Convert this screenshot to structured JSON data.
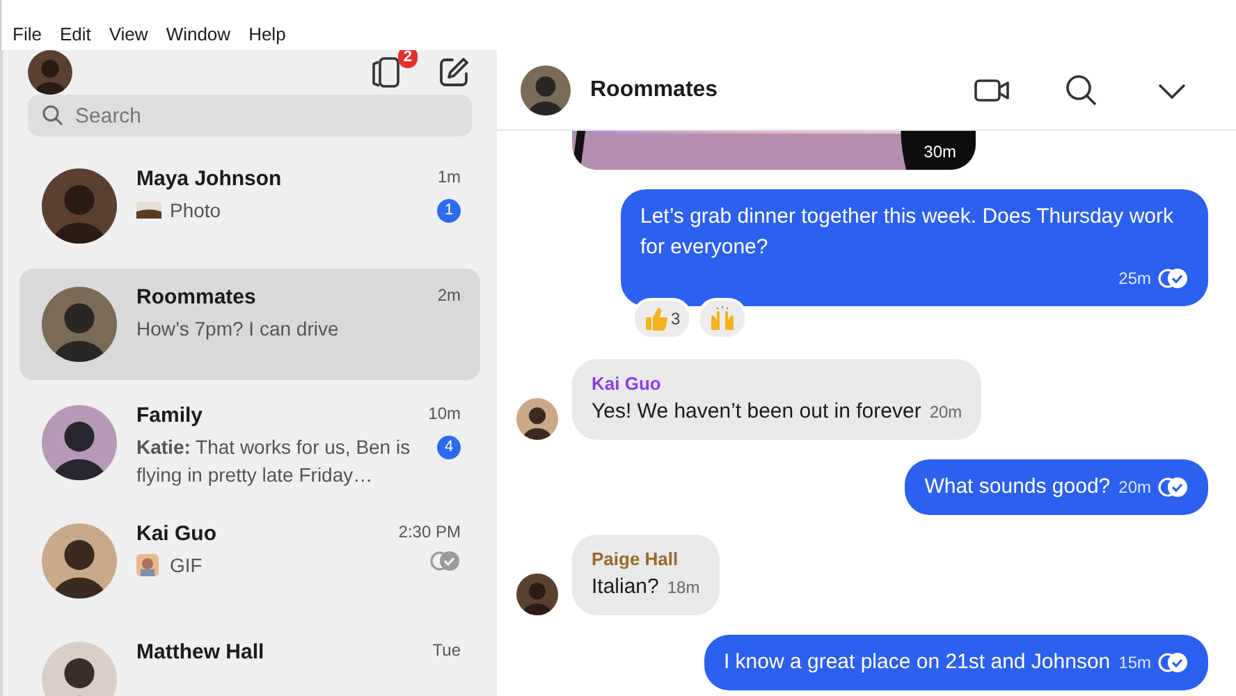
{
  "menu": [
    "File",
    "Edit",
    "View",
    "Window",
    "Help"
  ],
  "sidebar": {
    "notification_count": "2",
    "search": {
      "placeholder": "Search"
    },
    "conversations": [
      {
        "name": "Maya Johnson",
        "time": "1m",
        "preview": "Photo",
        "unread": "1",
        "selected": false
      },
      {
        "name": "Roommates",
        "time": "2m",
        "preview": "How’s 7pm? I can drive",
        "kind": "text",
        "selected": true
      },
      {
        "name": "Family",
        "time": "10m",
        "preview": "**Katie:** That works for us, Ben is flying in pretty late Friday…",
        "kind": "text",
        "unread": "4",
        "selected": false
      },
      {
        "name": "Kai Guo",
        "time": "2:30 PM",
        "preview": "GIF",
        "kind": "gif",
        "read": true,
        "selected": false
      },
      {
        "name": "Matthew Hall",
        "time": "Tue",
        "selected": false
      }
    ]
  },
  "chat": {
    "title": "Roommates",
    "messages": [
      {
        "time": "30m"
      },
      {
        "kind": "outgoing",
        "text": "Let’s grab dinner together this week. Does Thursday work for everyone?",
        "time": "25m",
        "read": true,
        "reactions": [
          {
            "kind": "thumbs-up",
            "count": "3"
          },
          {
            "kind": "raised-hands"
          }
        ]
      },
      {
        "kind": "incoming",
        "author": "Kai Guo",
        "color": "#8b3fe8",
        "text": "Yes! We haven’t been out in forever",
        "time": "20m"
      },
      {
        "kind": "outgoing",
        "text": "What sounds good?",
        "time": "20m",
        "read": true
      },
      {
        "kind": "incoming",
        "author": "Paige Hall",
        "color": "#9a6a2a",
        "text": "Italian?",
        "time": "18m"
      },
      {
        "kind": "outgoing",
        "text": "I know a great place on 21st and Johnson",
        "time": "15m",
        "read": true
      }
    ]
  }
}
